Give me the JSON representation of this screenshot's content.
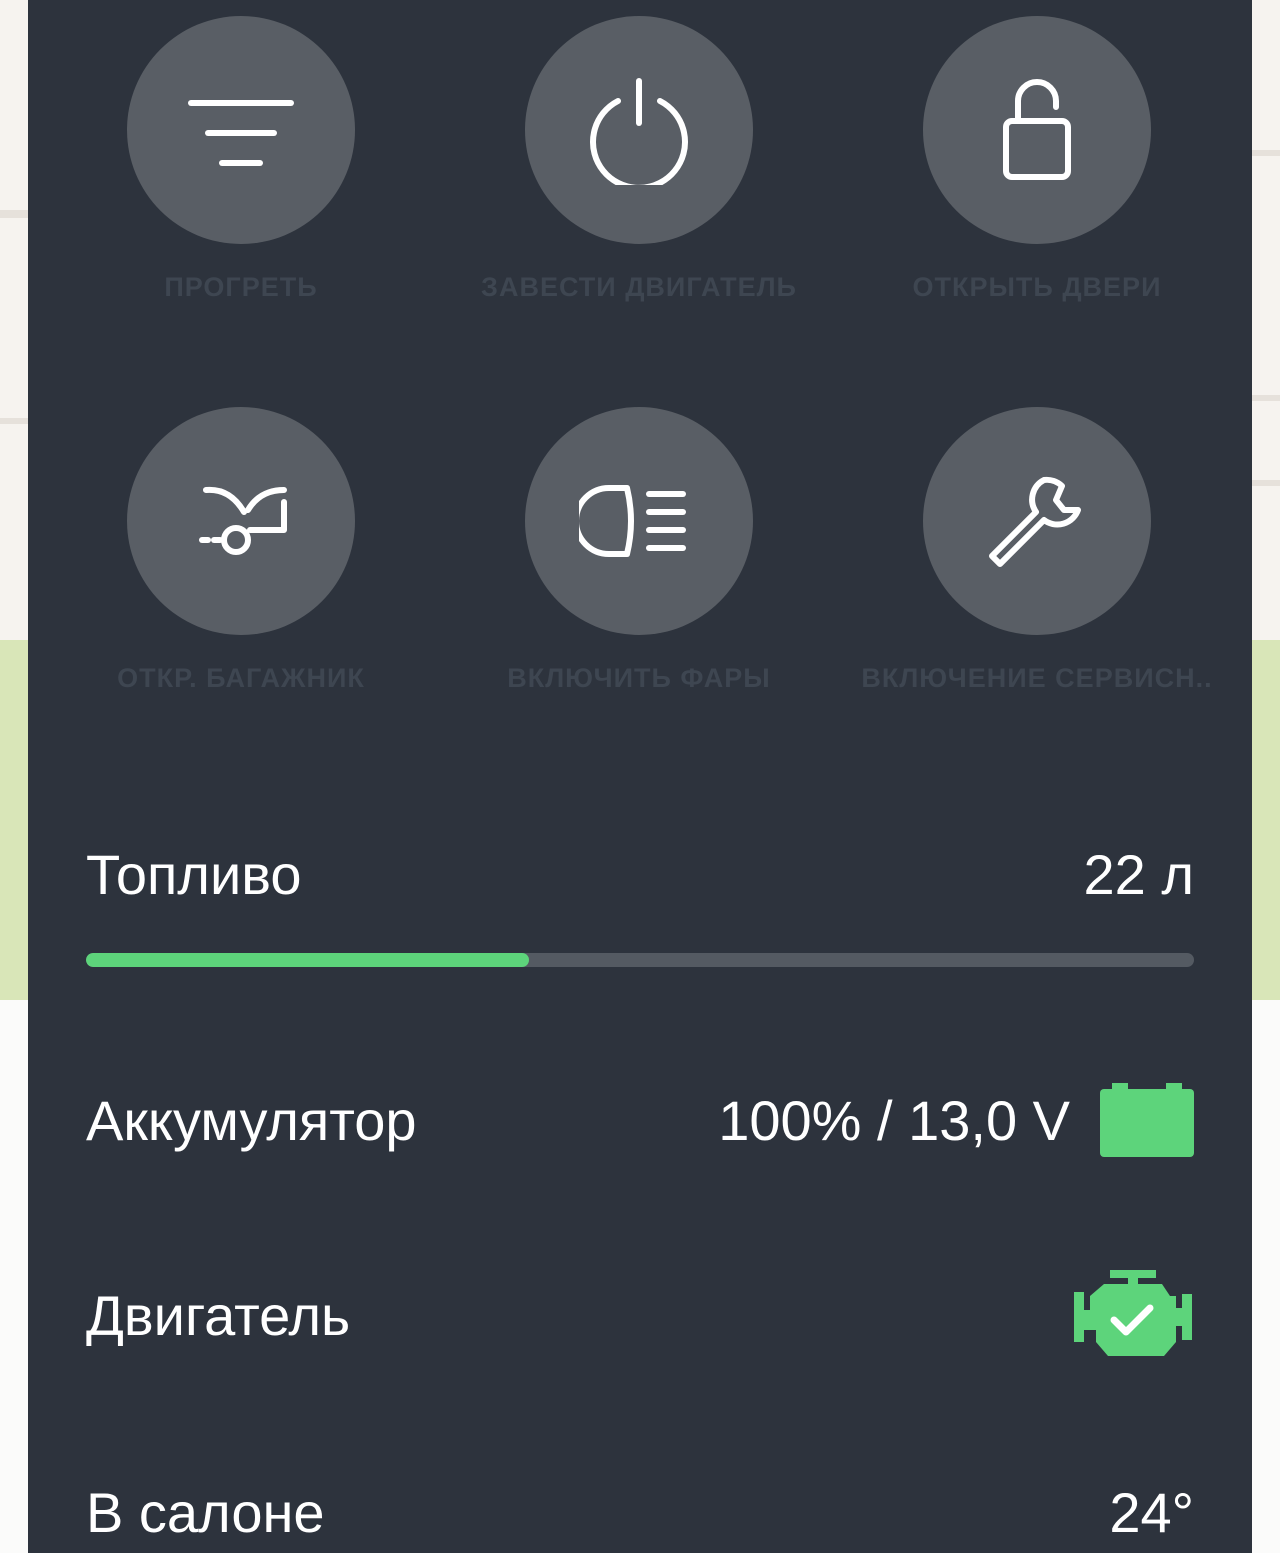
{
  "actions": [
    {
      "label": "ПРОГРЕТЬ",
      "icon": "heat-icon"
    },
    {
      "label": "ЗАВЕСТИ ДВИГАТЕЛЬ",
      "icon": "power-icon"
    },
    {
      "label": "ОТКРЫТЬ ДВЕРИ",
      "icon": "lock-icon"
    },
    {
      "label": "ОТКР. БАГАЖНИК",
      "icon": "trunk-icon"
    },
    {
      "label": "ВКЛЮЧИТЬ ФАРЫ",
      "icon": "headlights-icon"
    },
    {
      "label": "ВКЛЮЧЕНИЕ СЕРВИСН..",
      "icon": "wrench-icon"
    }
  ],
  "status": {
    "fuel": {
      "label": "Топливо",
      "value": "22 л",
      "level": 0.4
    },
    "battery": {
      "label": "Аккумулятор",
      "value": "100% / 13,0 V",
      "icon": "battery-icon"
    },
    "engine": {
      "label": "Двигатель",
      "icon": "engine-ok-icon"
    },
    "cabin": {
      "label": "В салоне",
      "value": "24°"
    }
  },
  "colors": {
    "panel": "#2d333d",
    "button": "#595e65",
    "accent": "#5dd47b",
    "label": "#3e4651"
  }
}
